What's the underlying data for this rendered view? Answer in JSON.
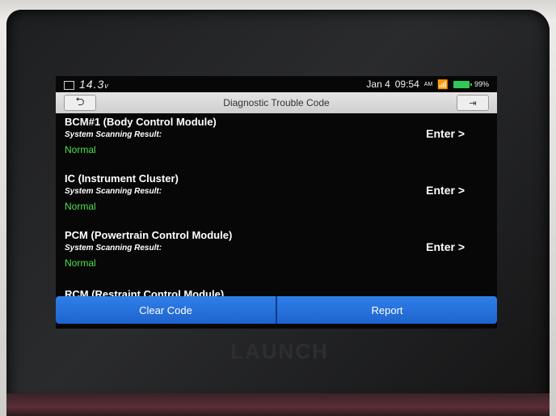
{
  "status_bar": {
    "voltage": "14.3",
    "voltage_unit": "v",
    "date": "Jan 4",
    "time": "09:54",
    "ampm": "AM",
    "battery_pct": "99%"
  },
  "header": {
    "title": "Diagnostic Trouble Code"
  },
  "systems": [
    {
      "name": "BCM#1 (Body Control Module)",
      "sub": "System Scanning Result:",
      "status": "Normal",
      "enter": "Enter >"
    },
    {
      "name": "IC (Instrument Cluster)",
      "sub": "System Scanning Result:",
      "status": "Normal",
      "enter": "Enter >"
    },
    {
      "name": "PCM (Powertrain Control Module)",
      "sub": "System Scanning Result:",
      "status": "Normal",
      "enter": "Enter >"
    },
    {
      "name": "RCM (Restraint Control Module)"
    }
  ],
  "footer": {
    "clear_label": "Clear Code",
    "report_label": "Report"
  },
  "device": {
    "brand": "LAUNCH"
  },
  "colors": {
    "accent_blue": "#2f7fe8",
    "status_green": "#4be04b"
  }
}
